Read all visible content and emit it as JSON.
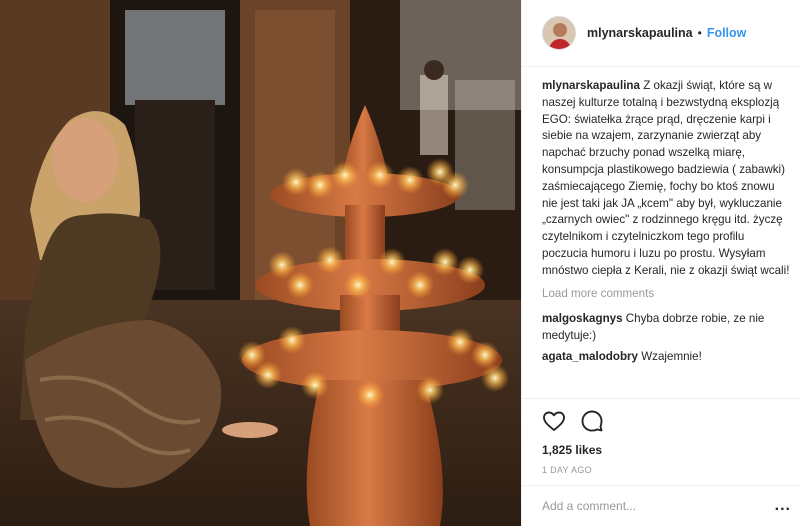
{
  "header": {
    "username": "mlynarskapaulina",
    "separator": "•",
    "follow_label": "Follow"
  },
  "caption": {
    "username": "mlynarskapaulina",
    "text": "Z okazji świąt, które są w naszej kulturze totalną i bezwstydną eksplozją EGO: światełka żrące prąd, dręczenie karpi i siebie na wzajem, zarzynanie zwierząt aby napchać brzuchy ponad wszelką miarę, konsumpcja plastikowego badziewia ( zabawki) zaśmiecającego Ziemię, fochy bo ktoś znowu nie jest taki jak JA „kcem\" aby był, wykluczanie „czarnych owiec\" z rodzinnego kręgu itd. życzę czytelnikom i czytelniczkom tego profilu poczucia humoru i luzu po prostu. Wysyłam mnóstwo ciepła z Kerali, nie z okazji świąt wcali!"
  },
  "load_more_label": "Load more comments",
  "comments": [
    {
      "username": "malgoskagnys",
      "text": "Chyba dobrze robie, ze nie medytuje:)"
    },
    {
      "username": "agata_malodobry",
      "text": "Wzajemnie!"
    }
  ],
  "actions": {
    "like_icon": "heart-outline-icon",
    "comment_icon": "speech-bubble-icon"
  },
  "likes_text": "1,825 likes",
  "timestamp": "1 DAY AGO",
  "add_comment": {
    "placeholder": "Add a comment...",
    "more_label": "..."
  },
  "colors": {
    "link_blue": "#3897f0",
    "text": "#262626",
    "muted": "#999999",
    "border": "#efefef"
  }
}
